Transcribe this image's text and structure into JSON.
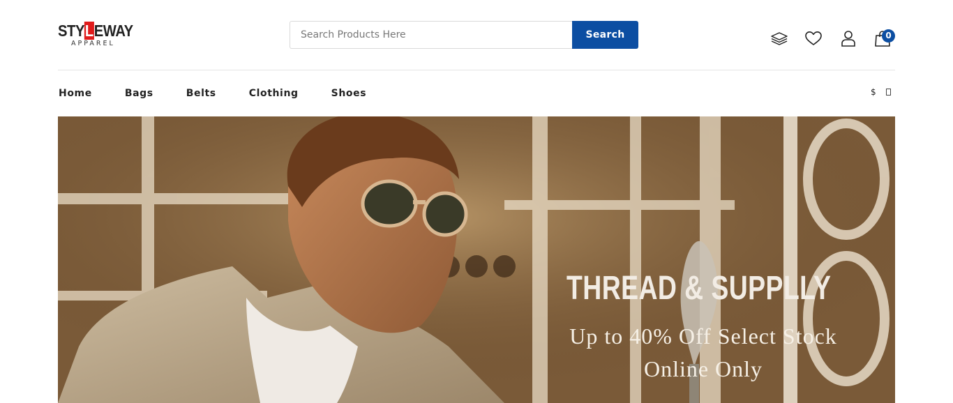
{
  "brand": {
    "logo_pre": "STY",
    "logo_mark": "L",
    "logo_post": "EWAY",
    "tagline": "APPAREL"
  },
  "search": {
    "placeholder": "Search Products Here",
    "value": "",
    "button_label": "Search"
  },
  "header_icons": [
    {
      "name": "layers-icon"
    },
    {
      "name": "heart-icon"
    },
    {
      "name": "user-icon"
    },
    {
      "name": "cart-icon",
      "badge": "0"
    }
  ],
  "nav": {
    "items": [
      "Home",
      "Bags",
      "Belts",
      "Clothing",
      "Shoes"
    ],
    "currency": "$"
  },
  "hero": {
    "title": "THREAD & SUPPLLY",
    "line1": "Up to 40% Off Select Stock",
    "line2": "Online Only"
  },
  "colors": {
    "accent": "#0c4ea2",
    "logo_red": "#e01b1b"
  }
}
